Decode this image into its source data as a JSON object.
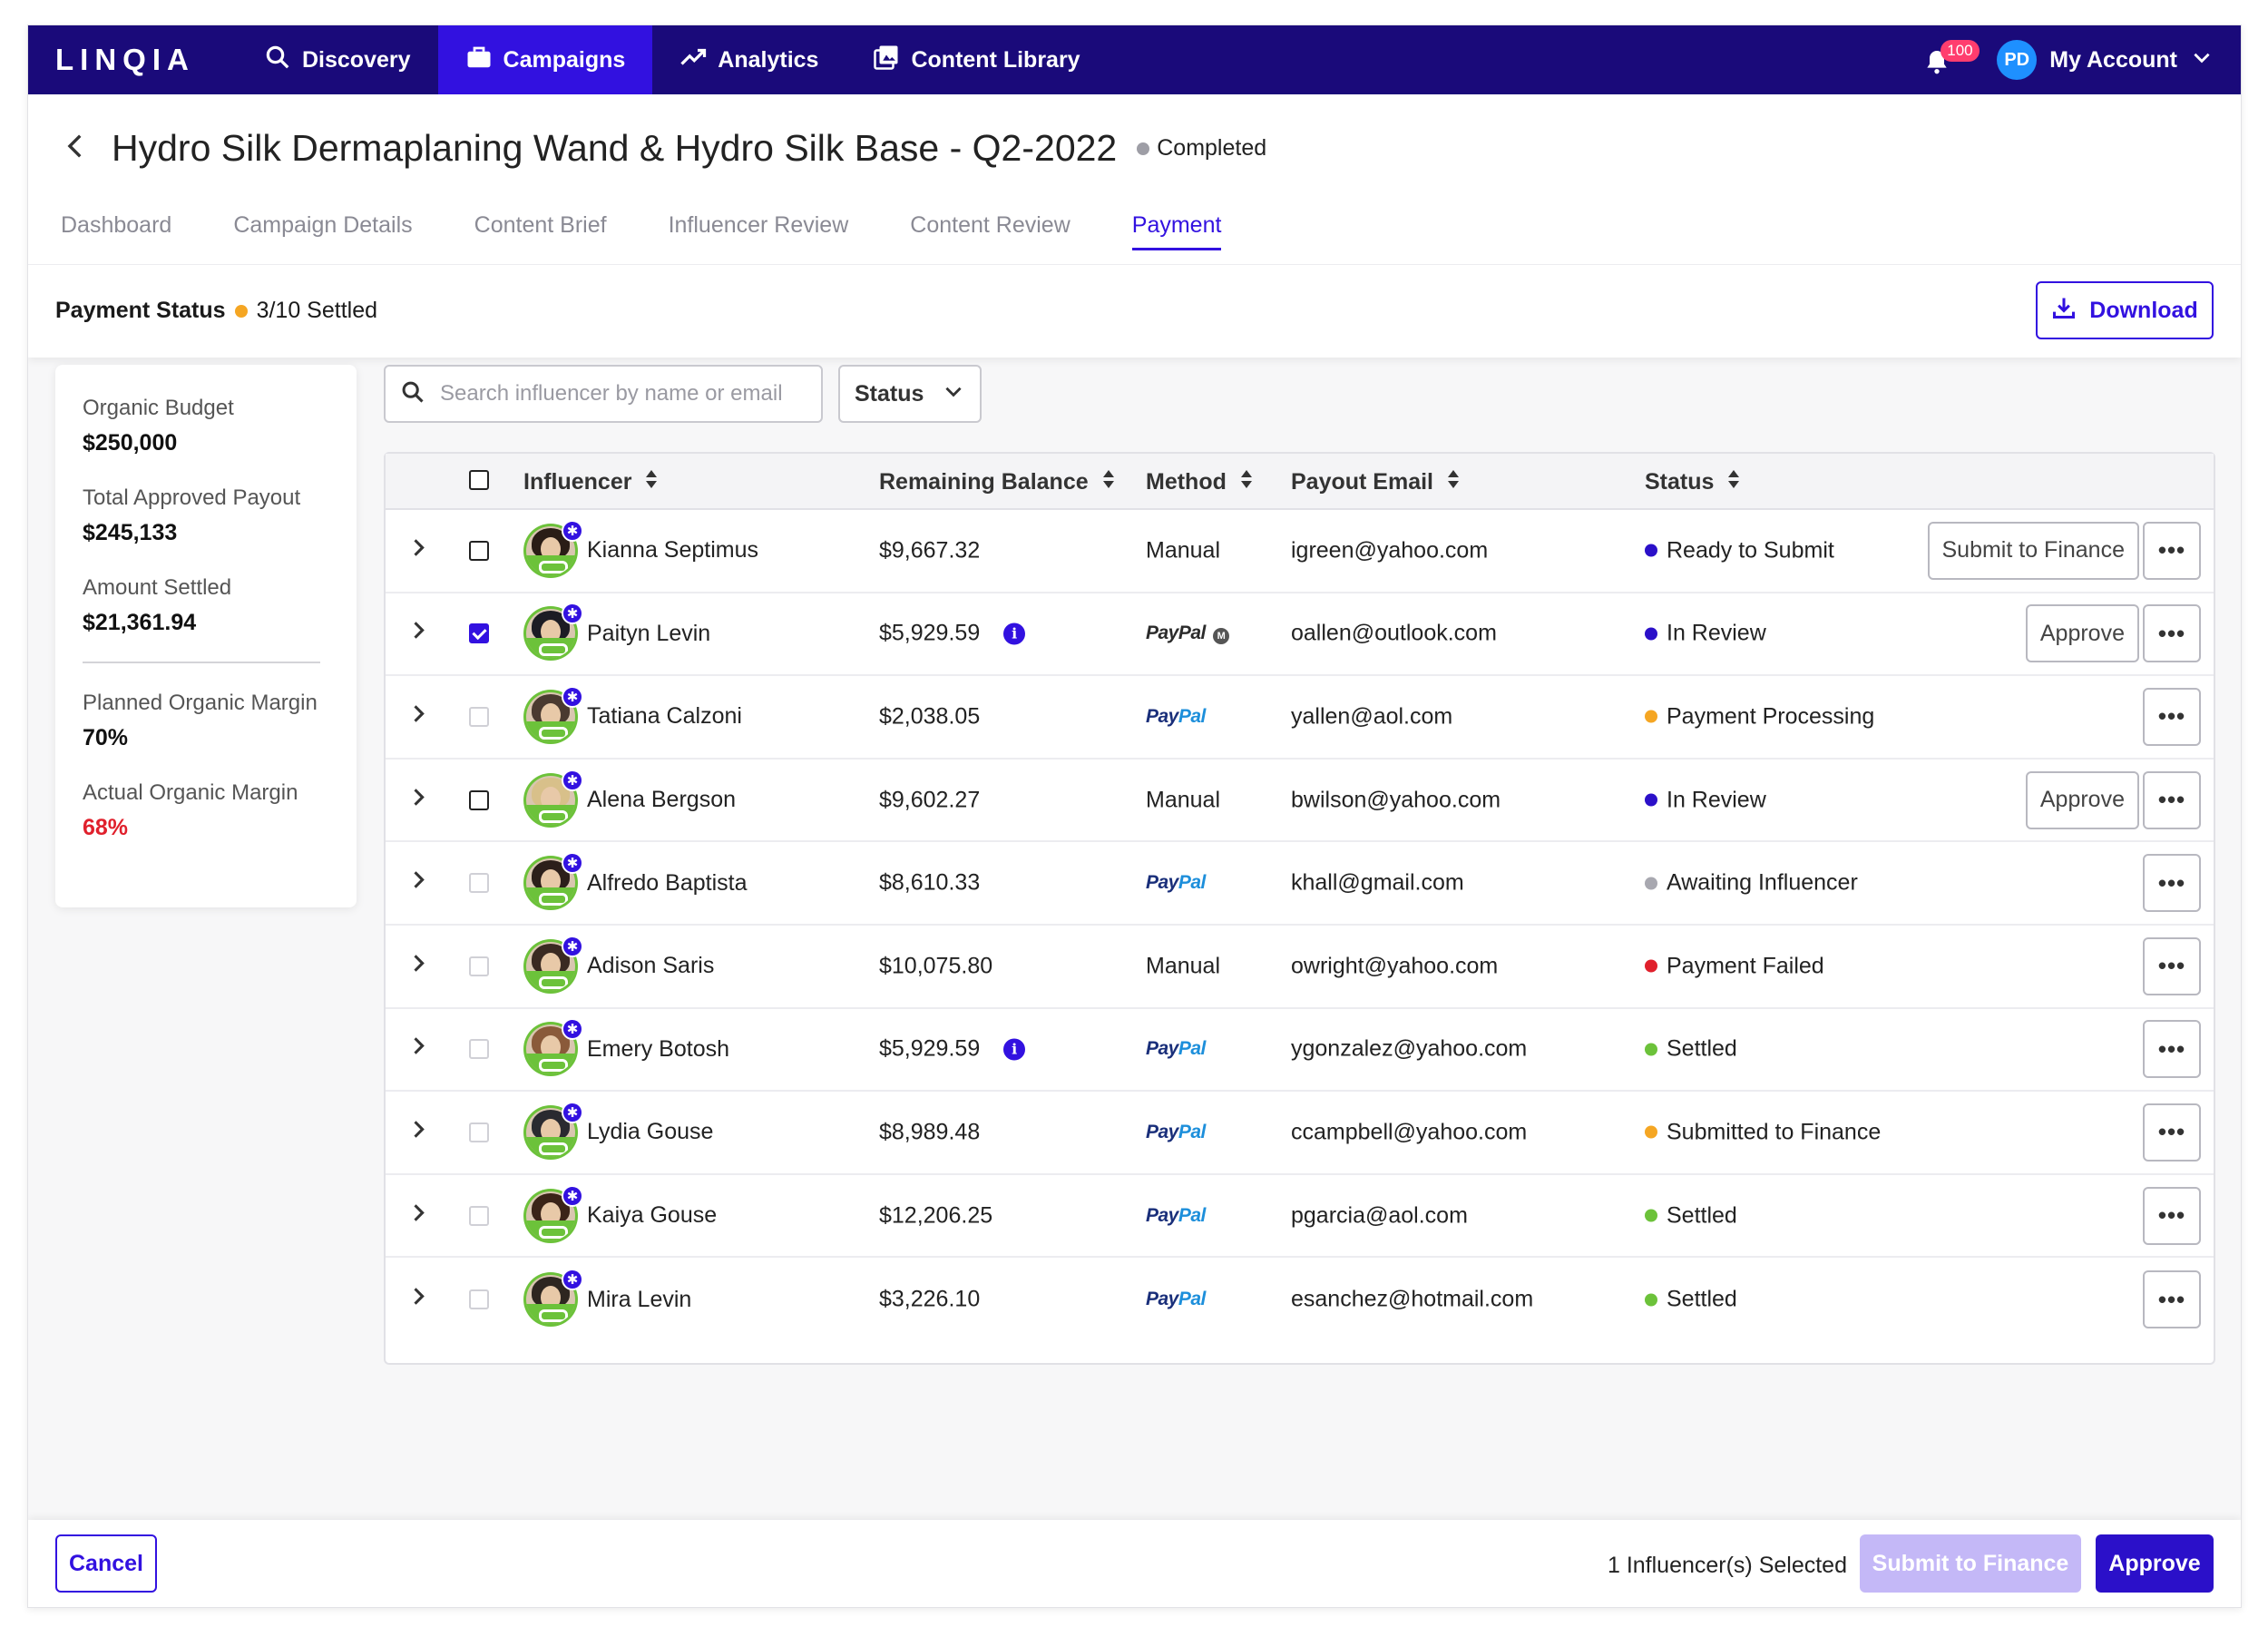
{
  "brand": {
    "logo": "LINQIA"
  },
  "nav": {
    "items": [
      {
        "label": "Discovery",
        "icon": "search-icon"
      },
      {
        "label": "Campaigns",
        "icon": "briefcase-icon",
        "active": true
      },
      {
        "label": "Analytics",
        "icon": "trending-up-icon"
      },
      {
        "label": "Content Library",
        "icon": "image-library-icon"
      }
    ],
    "notifications": "100",
    "avatar_initials": "PD",
    "account_label": "My Account"
  },
  "header": {
    "title": "Hydro Silk Dermaplaning Wand & Hydro Silk Base - Q2-2022",
    "status": "Completed",
    "status_color": "#9e9ea6",
    "tabs": [
      "Dashboard",
      "Campaign Details",
      "Content Brief",
      "Influencer Review",
      "Content Review",
      "Payment"
    ],
    "active_tab": "Payment",
    "payment_status_label": "Payment Status",
    "payment_status_value": "3/10 Settled",
    "payment_status_color": "#f5a623",
    "download_label": "Download"
  },
  "summary": {
    "organic_budget_label": "Organic Budget",
    "organic_budget": "$250,000",
    "total_approved_label": "Total Approved Payout",
    "total_approved": "$245,133",
    "amount_settled_label": "Amount Settled",
    "amount_settled": "$21,361.94",
    "planned_margin_label": "Planned Organic Margin",
    "planned_margin": "70%",
    "actual_margin_label": "Actual Organic Margin",
    "actual_margin": "68%"
  },
  "filters": {
    "search_placeholder": "Search influencer by name or email",
    "status_label": "Status"
  },
  "table": {
    "columns": {
      "influencer": "Influencer",
      "balance": "Remaining Balance",
      "method": "Method",
      "email": "Payout Email",
      "status": "Status"
    },
    "paypal_word_1": "Pay",
    "paypal_word_2": "Pal",
    "rows": [
      {
        "name": "Kianna Septimus",
        "balance": "$9,667.32",
        "method": "Manual",
        "email": "igreen@yahoo.com",
        "status": "Ready to Submit",
        "status_color": "#2b10c9",
        "checkbox": "empty",
        "action": "Submit to Finance",
        "info": false,
        "hair": "#2a1d16"
      },
      {
        "name": "Paityn Levin",
        "balance": "$5,929.59",
        "method": "PayPal",
        "paypal_mono": true,
        "email": "oallen@outlook.com",
        "status": "In Review",
        "status_color": "#2b10c9",
        "checkbox": "checked",
        "action": "Approve",
        "info": true,
        "hair": "#1c1c24"
      },
      {
        "name": "Tatiana Calzoni",
        "balance": "$2,038.05",
        "method": "PayPal",
        "email": "yallen@aol.com",
        "status": "Payment Processing",
        "status_color": "#f5a623",
        "checkbox": "light",
        "action": "",
        "info": false,
        "hair": "#4a3a30"
      },
      {
        "name": "Alena Bergson",
        "balance": "$9,602.27",
        "method": "Manual",
        "email": "bwilson@yahoo.com",
        "status": "In Review",
        "status_color": "#2b10c9",
        "checkbox": "empty",
        "action": "Approve",
        "info": false,
        "hair": "#d8c08a"
      },
      {
        "name": "Alfredo Baptista",
        "balance": "$8,610.33",
        "method": "PayPal",
        "email": "khall@gmail.com",
        "status": "Awaiting Influencer",
        "status_color": "#a8a8b0",
        "checkbox": "light",
        "action": "",
        "info": false,
        "hair": "#2c1f1a"
      },
      {
        "name": "Adison Saris",
        "balance": "$10,075.80",
        "method": "Manual",
        "email": "owright@yahoo.com",
        "status": "Payment Failed",
        "status_color": "#e0202c",
        "checkbox": "light",
        "action": "",
        "info": false,
        "hair": "#3a2a22"
      },
      {
        "name": "Emery Botosh",
        "balance": "$5,929.59",
        "method": "PayPal",
        "email": "ygonzalez@yahoo.com",
        "status": "Settled",
        "status_color": "#6cc23a",
        "checkbox": "light",
        "action": "",
        "info": true,
        "hair": "#8a5a3a"
      },
      {
        "name": "Lydia Gouse",
        "balance": "$8,989.48",
        "method": "PayPal",
        "email": "ccampbell@yahoo.com",
        "status": "Submitted to Finance",
        "status_color": "#f5a623",
        "checkbox": "light",
        "action": "",
        "info": false,
        "hair": "#2a2a30"
      },
      {
        "name": "Kaiya Gouse",
        "balance": "$12,206.25",
        "method": "PayPal",
        "email": "pgarcia@aol.com",
        "status": "Settled",
        "status_color": "#6cc23a",
        "checkbox": "light",
        "action": "",
        "info": false,
        "hair": "#3b2418"
      },
      {
        "name": "Mira Levin",
        "balance": "$3,226.10",
        "method": "PayPal",
        "email": "esanchez@hotmail.com",
        "status": "Settled",
        "status_color": "#6cc23a",
        "checkbox": "light",
        "action": "",
        "info": false,
        "hair": "#2e2620"
      }
    ]
  },
  "footer": {
    "cancel": "Cancel",
    "selected_text": "1 Influencer(s) Selected",
    "submit_finance": "Submit to Finance",
    "approve": "Approve"
  }
}
